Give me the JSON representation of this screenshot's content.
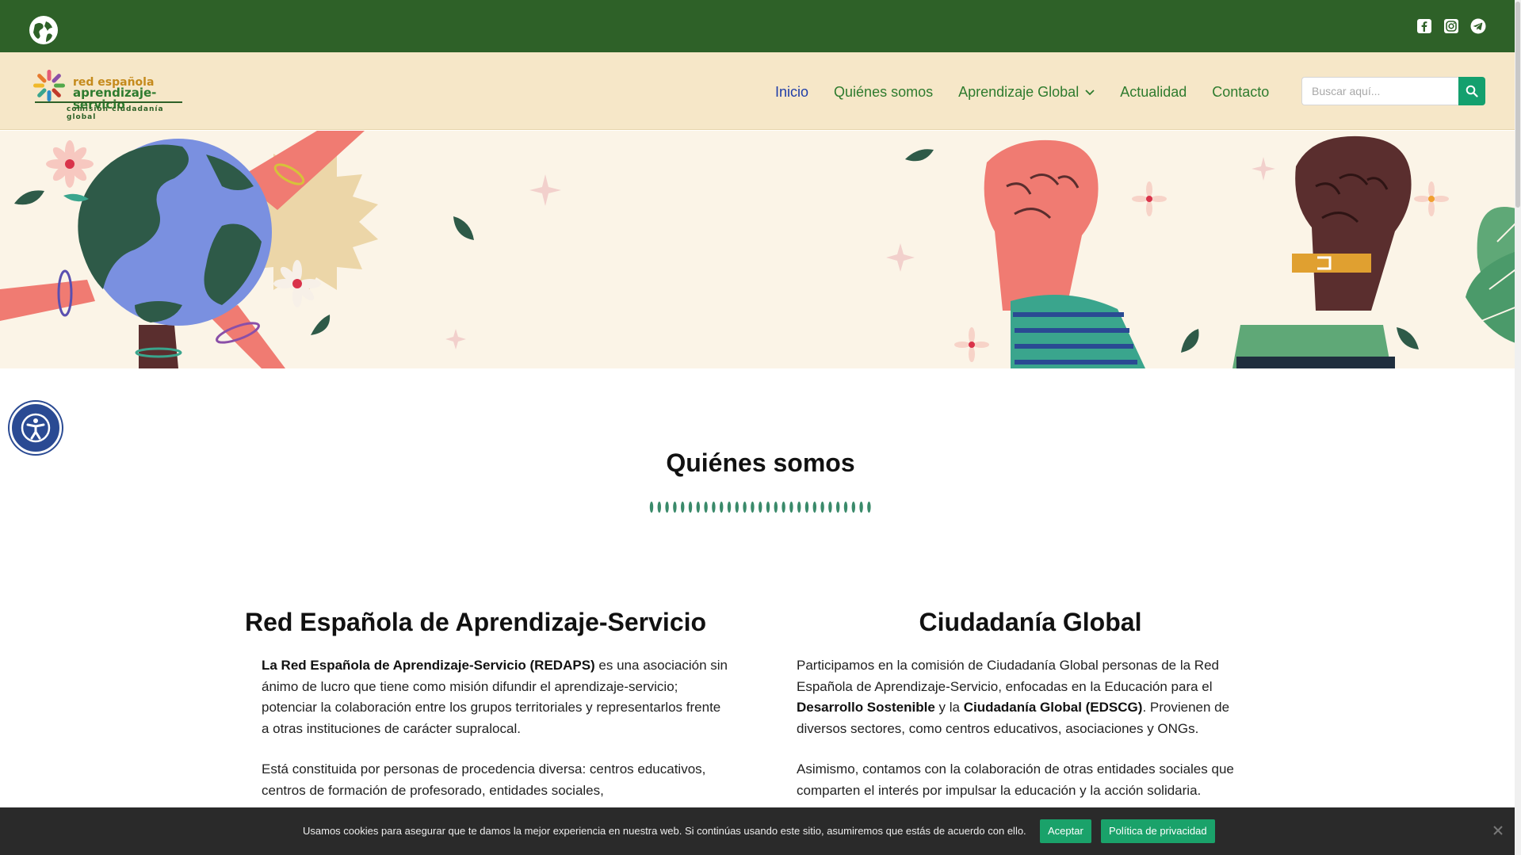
{
  "topbar": {
    "icons": [
      "globe-icon",
      "facebook-icon",
      "instagram-icon",
      "telegram-icon"
    ],
    "bg_color": "#2e6128"
  },
  "header": {
    "logo": {
      "line1": "red española",
      "line2": "aprendizaje-servicio",
      "line3": "comisión ciudadanía global"
    },
    "nav": [
      {
        "label": "Inicio",
        "active": true
      },
      {
        "label": "Quiénes somos"
      },
      {
        "label": "Aprendizaje Global",
        "has_dropdown": true
      },
      {
        "label": "Actualidad"
      },
      {
        "label": "Contacto"
      }
    ],
    "search": {
      "placeholder": "Buscar aquí..."
    },
    "bg_color": "#f6e7c8"
  },
  "main": {
    "section_title": "Quiénes somos",
    "left": {
      "title": "Red Española de Aprendizaje-Servicio",
      "p1_bold": "La Red Española de Aprendizaje-Servicio (REDAPS)",
      "p1_rest": " es una asociación sin ánimo de lucro que  tiene como misión difundir el aprendizaje-servicio; potenciar la colaboración entre los grupos territoriales y representarlos frente a otras instituciones de carácter supralocal.",
      "p2": "Está constituida por personas de procedencia diversa: centros educativos, centros de formación de profesorado, entidades sociales,"
    },
    "right": {
      "title": "Ciudadanía Global",
      "p1_a": "Participamos en la comisión de Ciudadanía Global personas de la Red Española de Aprendizaje-Servicio, enfocadas en la Educación para el ",
      "p1_b1": "Desarrollo Sostenible",
      "p1_c": " y la ",
      "p1_b2": "Ciudadanía Global (EDSCG)",
      "p1_d": ".  Provienen de diversos sectores, como centros educativos, asociaciones y ONGs.",
      "p2": "Asimismo, contamos con la colaboración de otras entidades sociales que comparten el interés por impulsar la educación y la acción solidaria."
    }
  },
  "cookie": {
    "message": "Usamos cookies para asegurar que te damos la mejor experiencia en nuestra web. Si continúas usando este sitio, asumiremos que estás de acuerdo con ello.",
    "accept": "Aceptar",
    "privacy": "Política de privacidad"
  },
  "colors": {
    "accent": "#14a06e",
    "nav_text": "#2e7b2e",
    "nav_active": "#1e3da8"
  }
}
